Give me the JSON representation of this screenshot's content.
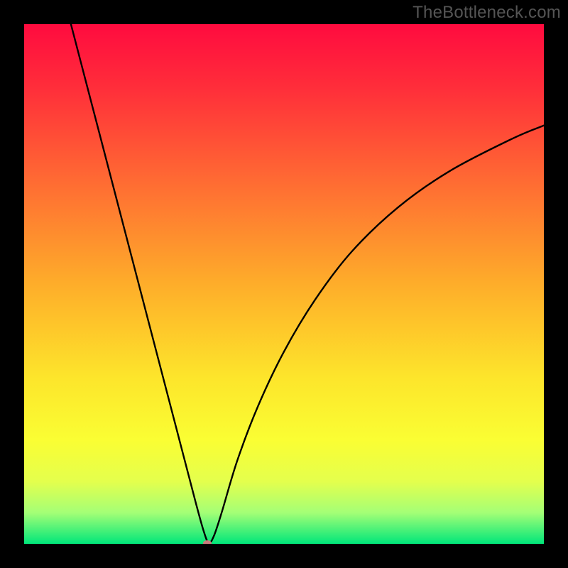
{
  "watermark": "TheBottleneck.com",
  "chart_data": {
    "type": "line",
    "title": "",
    "xlabel": "",
    "ylabel": "",
    "xlim": [
      0,
      100
    ],
    "ylim": [
      0,
      100
    ],
    "background_gradient_stops": [
      {
        "pos": 0.0,
        "color": "#ff0b3f"
      },
      {
        "pos": 0.12,
        "color": "#ff2d3a"
      },
      {
        "pos": 0.3,
        "color": "#ff6a33"
      },
      {
        "pos": 0.5,
        "color": "#fead2a"
      },
      {
        "pos": 0.68,
        "color": "#fde52b"
      },
      {
        "pos": 0.8,
        "color": "#fafe33"
      },
      {
        "pos": 0.88,
        "color": "#e4ff4d"
      },
      {
        "pos": 0.94,
        "color": "#a4ff76"
      },
      {
        "pos": 1.0,
        "color": "#00e67a"
      }
    ],
    "series": [
      {
        "name": "bottleneck-curve",
        "x": [
          9,
          12,
          15,
          18,
          21,
          24,
          27,
          30,
          33,
          34.5,
          35.5,
          36.5,
          38,
          41,
          45,
          50,
          56,
          63,
          72,
          82,
          94,
          100
        ],
        "y": [
          100,
          88.5,
          77,
          65.5,
          54,
          42.5,
          31,
          19.5,
          8,
          2.6,
          0.2,
          1.5,
          6,
          16,
          26.5,
          37,
          47,
          56.2,
          64.8,
          71.8,
          78,
          80.5
        ]
      }
    ],
    "marker": {
      "x": 35.3,
      "y": 0.2,
      "color": "#c77b7c"
    }
  }
}
